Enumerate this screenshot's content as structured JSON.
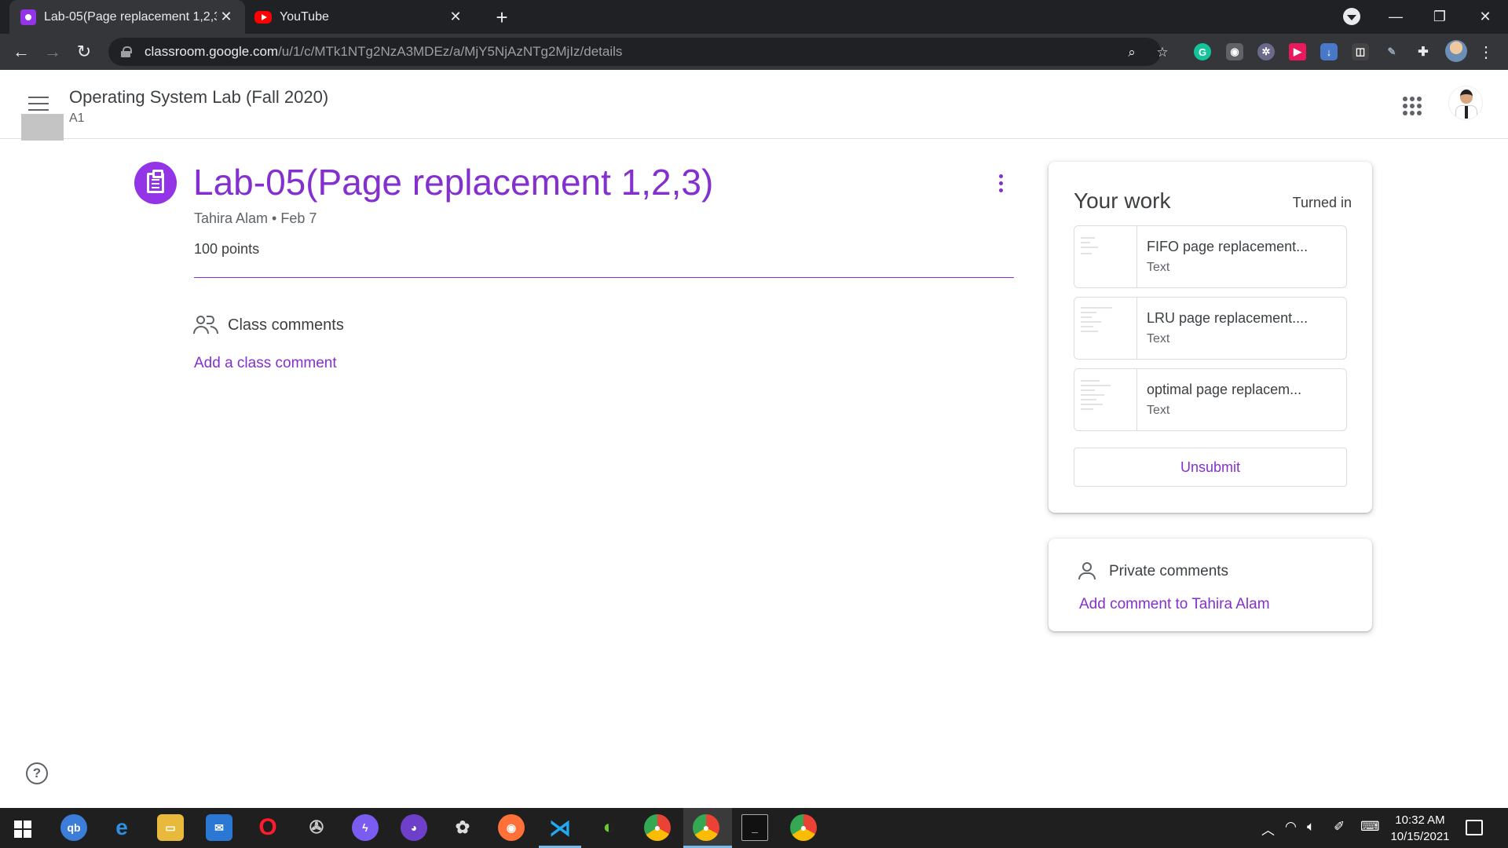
{
  "browser": {
    "tabs": [
      {
        "label": "Lab-05(Page replacement 1,2,3)",
        "active": true,
        "icon": "google-classroom-icon"
      },
      {
        "label": "YouTube",
        "active": false,
        "icon": "youtube-icon"
      }
    ],
    "url_host": "classroom.google.com",
    "url_path": "/u/1/c/MTk1NTg2NzA3MDEz/a/MjY5NjAzNTg2MjIz/details"
  },
  "header": {
    "course_title": "Operating System Lab (Fall 2020)",
    "course_section": "A1"
  },
  "assignment": {
    "title": "Lab-05(Page replacement 1,2,3)",
    "meta": "Tahira Alam • Feb 7",
    "points": "100 points",
    "class_comments_label": "Class comments",
    "add_class_comment": "Add a class comment"
  },
  "your_work": {
    "title": "Your work",
    "status": "Turned in",
    "attachments": [
      {
        "name": "FIFO page replacement...",
        "type": "Text"
      },
      {
        "name": "LRU page replacement....",
        "type": "Text"
      },
      {
        "name": "optimal page replacem...",
        "type": "Text"
      }
    ],
    "unsubmit_label": "Unsubmit"
  },
  "private_comments": {
    "label": "Private comments",
    "add_link": "Add comment to Tahira Alam"
  },
  "taskbar": {
    "time": "10:32 AM",
    "date": "10/15/2021"
  },
  "colors": {
    "accent": "#8430ce",
    "assignment_icon_bg": "#9334e6",
    "chrome_dark": "#202124",
    "chrome_toolbar": "#35363a",
    "taskbar": "#1f1f1f"
  }
}
